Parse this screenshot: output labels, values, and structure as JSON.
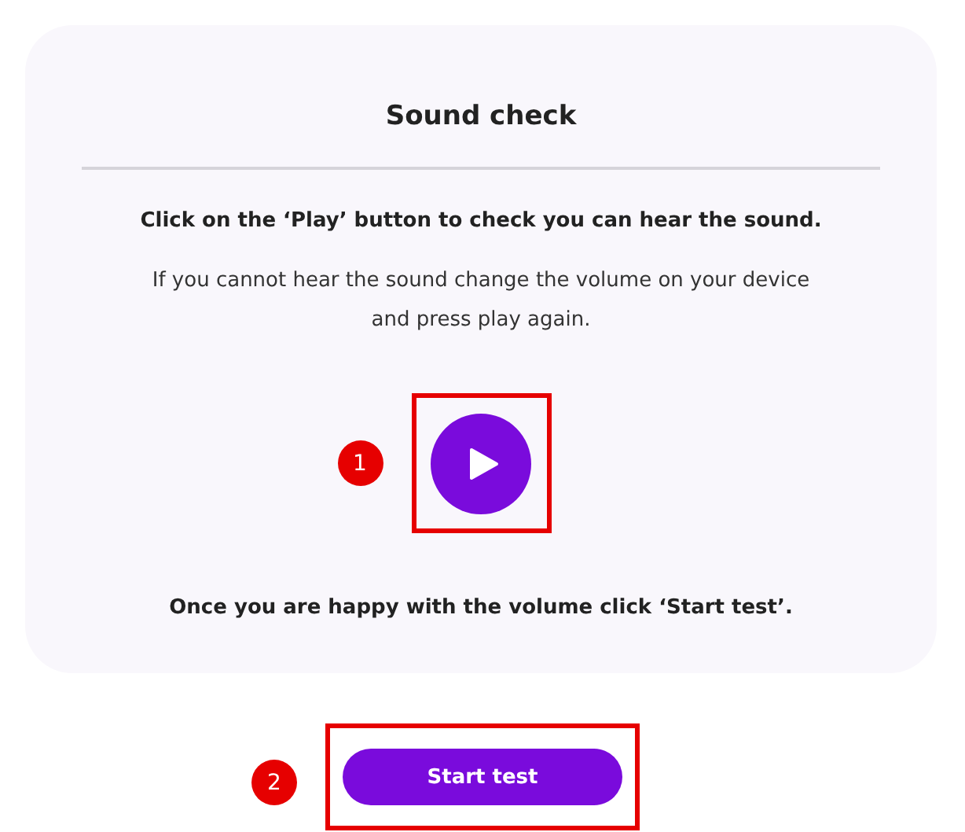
{
  "card": {
    "title": "Sound check",
    "instruction": "Click on the ‘Play’ button to check you can hear the sound.",
    "help": "If you cannot hear the sound change the volume on your device and press play again.",
    "play_button": {
      "annotation": "1"
    },
    "closing": "Once you are happy with the volume click ‘Start test’."
  },
  "start_button": {
    "label": "Start test",
    "annotation": "2"
  }
}
